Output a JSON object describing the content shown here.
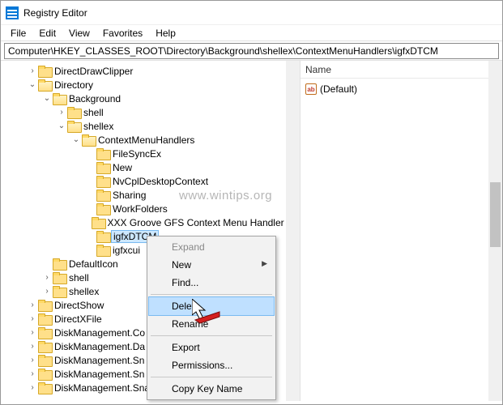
{
  "window": {
    "title": "Registry Editor"
  },
  "menubar": [
    "File",
    "Edit",
    "View",
    "Favorites",
    "Help"
  ],
  "address": "Computer\\HKEY_CLASSES_ROOT\\Directory\\Background\\shellex\\ContextMenuHandlers\\igfxDTCM",
  "list": {
    "header": "Name",
    "items": [
      {
        "name": "(Default)"
      }
    ]
  },
  "tree": [
    {
      "level": 0,
      "exp": "closed",
      "label": "DirectDrawClipper"
    },
    {
      "level": 0,
      "exp": "open",
      "label": "Directory",
      "open": true
    },
    {
      "level": 1,
      "exp": "open",
      "label": "Background",
      "open": true
    },
    {
      "level": 2,
      "exp": "closed",
      "label": "shell"
    },
    {
      "level": 2,
      "exp": "open",
      "label": "shellex",
      "open": true
    },
    {
      "level": 3,
      "exp": "open",
      "label": "ContextMenuHandlers",
      "open": true
    },
    {
      "level": 4,
      "exp": "none",
      "label": "FileSyncEx"
    },
    {
      "level": 4,
      "exp": "none",
      "label": "New"
    },
    {
      "level": 4,
      "exp": "none",
      "label": "NvCplDesktopContext"
    },
    {
      "level": 4,
      "exp": "none",
      "label": "Sharing"
    },
    {
      "level": 4,
      "exp": "none",
      "label": "WorkFolders"
    },
    {
      "level": 4,
      "exp": "none",
      "label": "XXX Groove GFS Context Menu Handler XX"
    },
    {
      "level": 4,
      "exp": "none",
      "label": "igfxDTCM",
      "selected": true
    },
    {
      "level": 4,
      "exp": "none",
      "label": "igfxcui"
    },
    {
      "level": 1,
      "exp": "none",
      "label": "DefaultIcon"
    },
    {
      "level": 1,
      "exp": "closed",
      "label": "shell"
    },
    {
      "level": 1,
      "exp": "closed",
      "label": "shellex"
    },
    {
      "level": 0,
      "exp": "closed",
      "label": "DirectShow"
    },
    {
      "level": 0,
      "exp": "closed",
      "label": "DirectXFile"
    },
    {
      "level": 0,
      "exp": "closed",
      "label": "DiskManagement.Co"
    },
    {
      "level": 0,
      "exp": "closed",
      "label": "DiskManagement.Da"
    },
    {
      "level": 0,
      "exp": "closed",
      "label": "DiskManagement.Sn"
    },
    {
      "level": 0,
      "exp": "closed",
      "label": "DiskManagement.Sn"
    },
    {
      "level": 0,
      "exp": "closed",
      "label": "DiskManagement.SnapInComponent"
    }
  ],
  "contextmenu": {
    "items": [
      {
        "label": "Expand",
        "disabled": true
      },
      {
        "label": "New",
        "arrow": true
      },
      {
        "label": "Find..."
      },
      {
        "sep": true
      },
      {
        "label": "Delete",
        "highlight": true
      },
      {
        "label": "Rename"
      },
      {
        "sep": true
      },
      {
        "label": "Export"
      },
      {
        "label": "Permissions..."
      },
      {
        "sep": true
      },
      {
        "label": "Copy Key Name"
      }
    ]
  },
  "watermark": "www.wintips.org"
}
